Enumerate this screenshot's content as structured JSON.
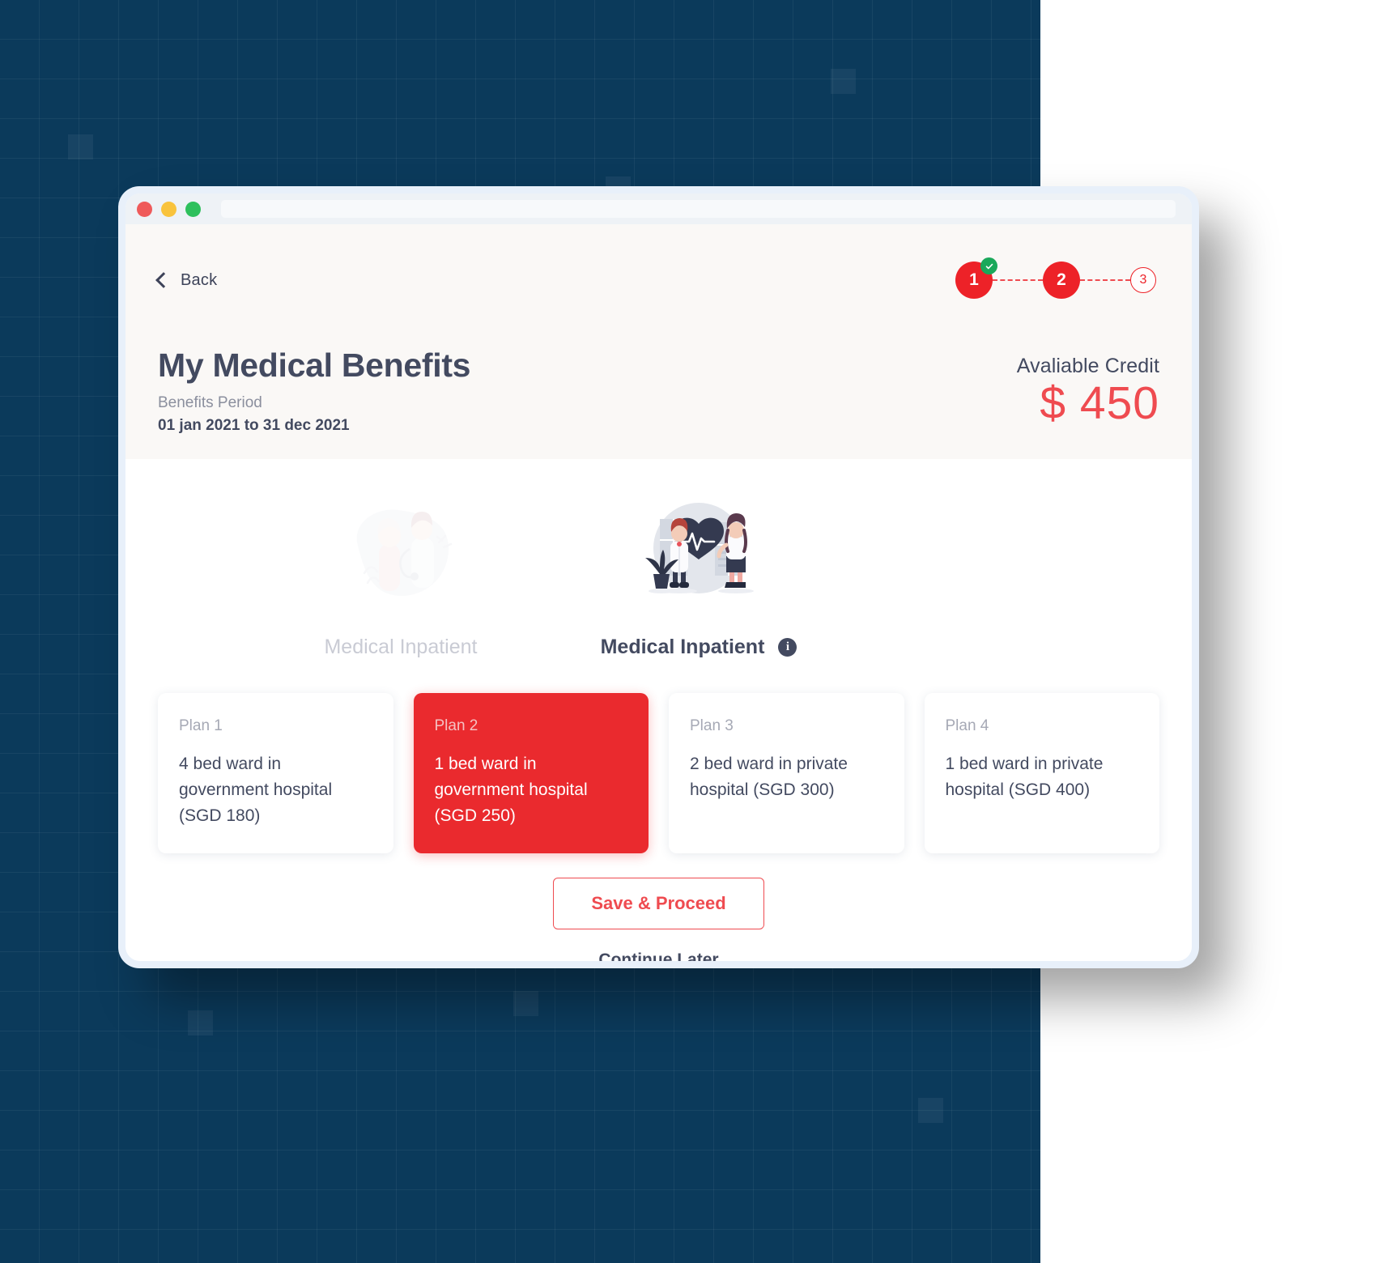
{
  "window": {
    "traffic_lights": [
      "close",
      "minimize",
      "maximize"
    ]
  },
  "header": {
    "back_label": "Back",
    "page_title": "My Medical Benefits",
    "period_label": "Benefits Period",
    "period_value": "01 jan 2021 to 31 dec 2021",
    "credit_label": "Avaliable Credit",
    "credit_value": "$ 450",
    "accent_color": "#ef4b50"
  },
  "stepper": {
    "steps": [
      {
        "number": "1",
        "state": "completed"
      },
      {
        "number": "2",
        "state": "current"
      },
      {
        "number": "3",
        "state": "upcoming"
      }
    ]
  },
  "categories": [
    {
      "label": "Medical Inpatient",
      "active": false,
      "has_info": false
    },
    {
      "label": "Medical Inpatient",
      "active": true,
      "has_info": true
    }
  ],
  "plans": [
    {
      "name": "Plan 1",
      "description": "4 bed ward in government hospital (SGD 180)",
      "selected": false
    },
    {
      "name": "Plan 2",
      "description": "1 bed ward in government hospital (SGD 250)",
      "selected": true
    },
    {
      "name": "Plan 3",
      "description": "2 bed ward in private hospital (SGD 300)",
      "selected": false
    },
    {
      "name": "Plan 4",
      "description": "1 bed ward in private hospital (SGD 400)",
      "selected": false
    }
  ],
  "actions": {
    "save_label": "Save & Proceed",
    "continue_later_label": "Continue Later"
  }
}
